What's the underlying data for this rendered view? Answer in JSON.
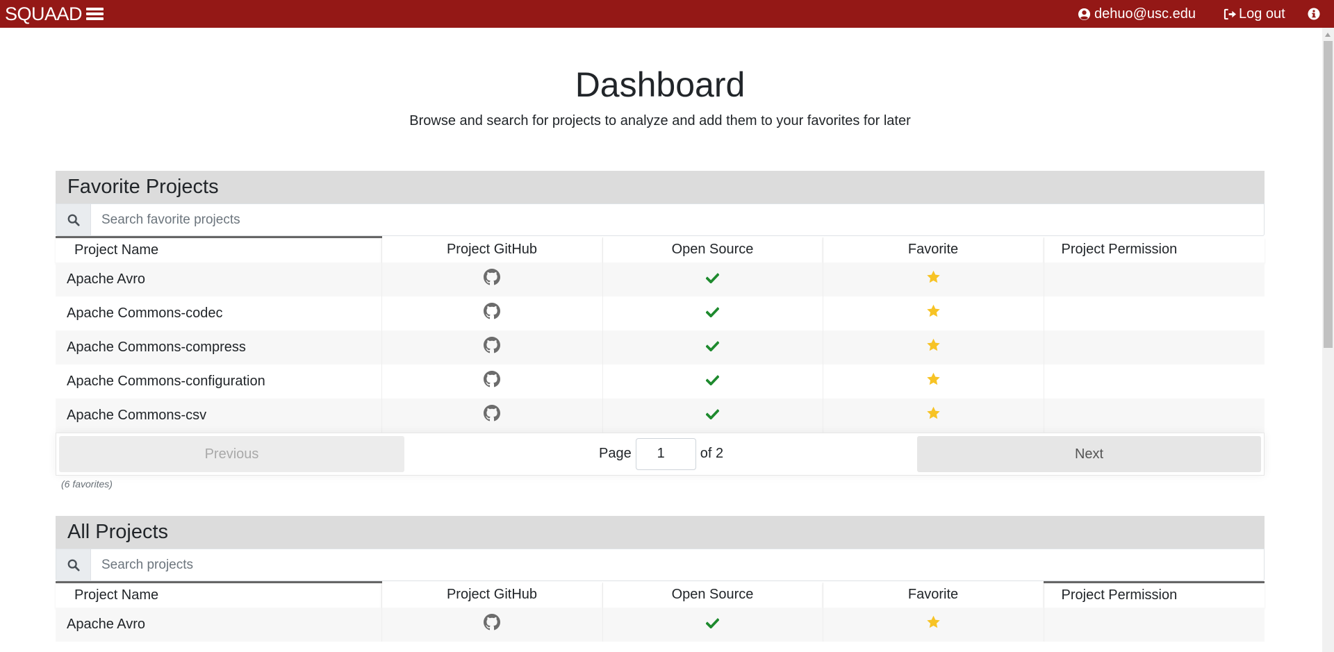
{
  "navbar": {
    "brand": "SQUAAD",
    "user_email": "dehuo@usc.edu",
    "logout_label": "Log out",
    "bg_color": "#941816"
  },
  "header": {
    "title": "Dashboard",
    "subtitle": "Browse and search for projects to analyze and add them to your favorites for later"
  },
  "columns": {
    "name": "Project Name",
    "github": "Project GitHub",
    "open_source": "Open Source",
    "favorite": "Favorite",
    "permission": "Project Permission"
  },
  "favorites": {
    "heading": "Favorite Projects",
    "search_placeholder": "Search favorite projects",
    "rows": [
      {
        "name": "Apache Avro",
        "open_source": true,
        "favorite": true
      },
      {
        "name": "Apache Commons-codec",
        "open_source": true,
        "favorite": true
      },
      {
        "name": "Apache Commons-compress",
        "open_source": true,
        "favorite": true
      },
      {
        "name": "Apache Commons-configuration",
        "open_source": true,
        "favorite": true
      },
      {
        "name": "Apache Commons-csv",
        "open_source": true,
        "favorite": true
      }
    ],
    "pagination": {
      "previous_label": "Previous",
      "next_label": "Next",
      "page_label": "Page",
      "page_value": "1",
      "of_label": "of 2"
    },
    "count_note": "(6 favorites)"
  },
  "all_projects": {
    "heading": "All Projects",
    "search_placeholder": "Search projects",
    "rows": [
      {
        "name": "Apache Avro",
        "open_source": true,
        "favorite": true
      }
    ]
  },
  "colors": {
    "check": "#1e8a2e",
    "star": "#f7c325",
    "github_icon": "#6c6c6c"
  }
}
